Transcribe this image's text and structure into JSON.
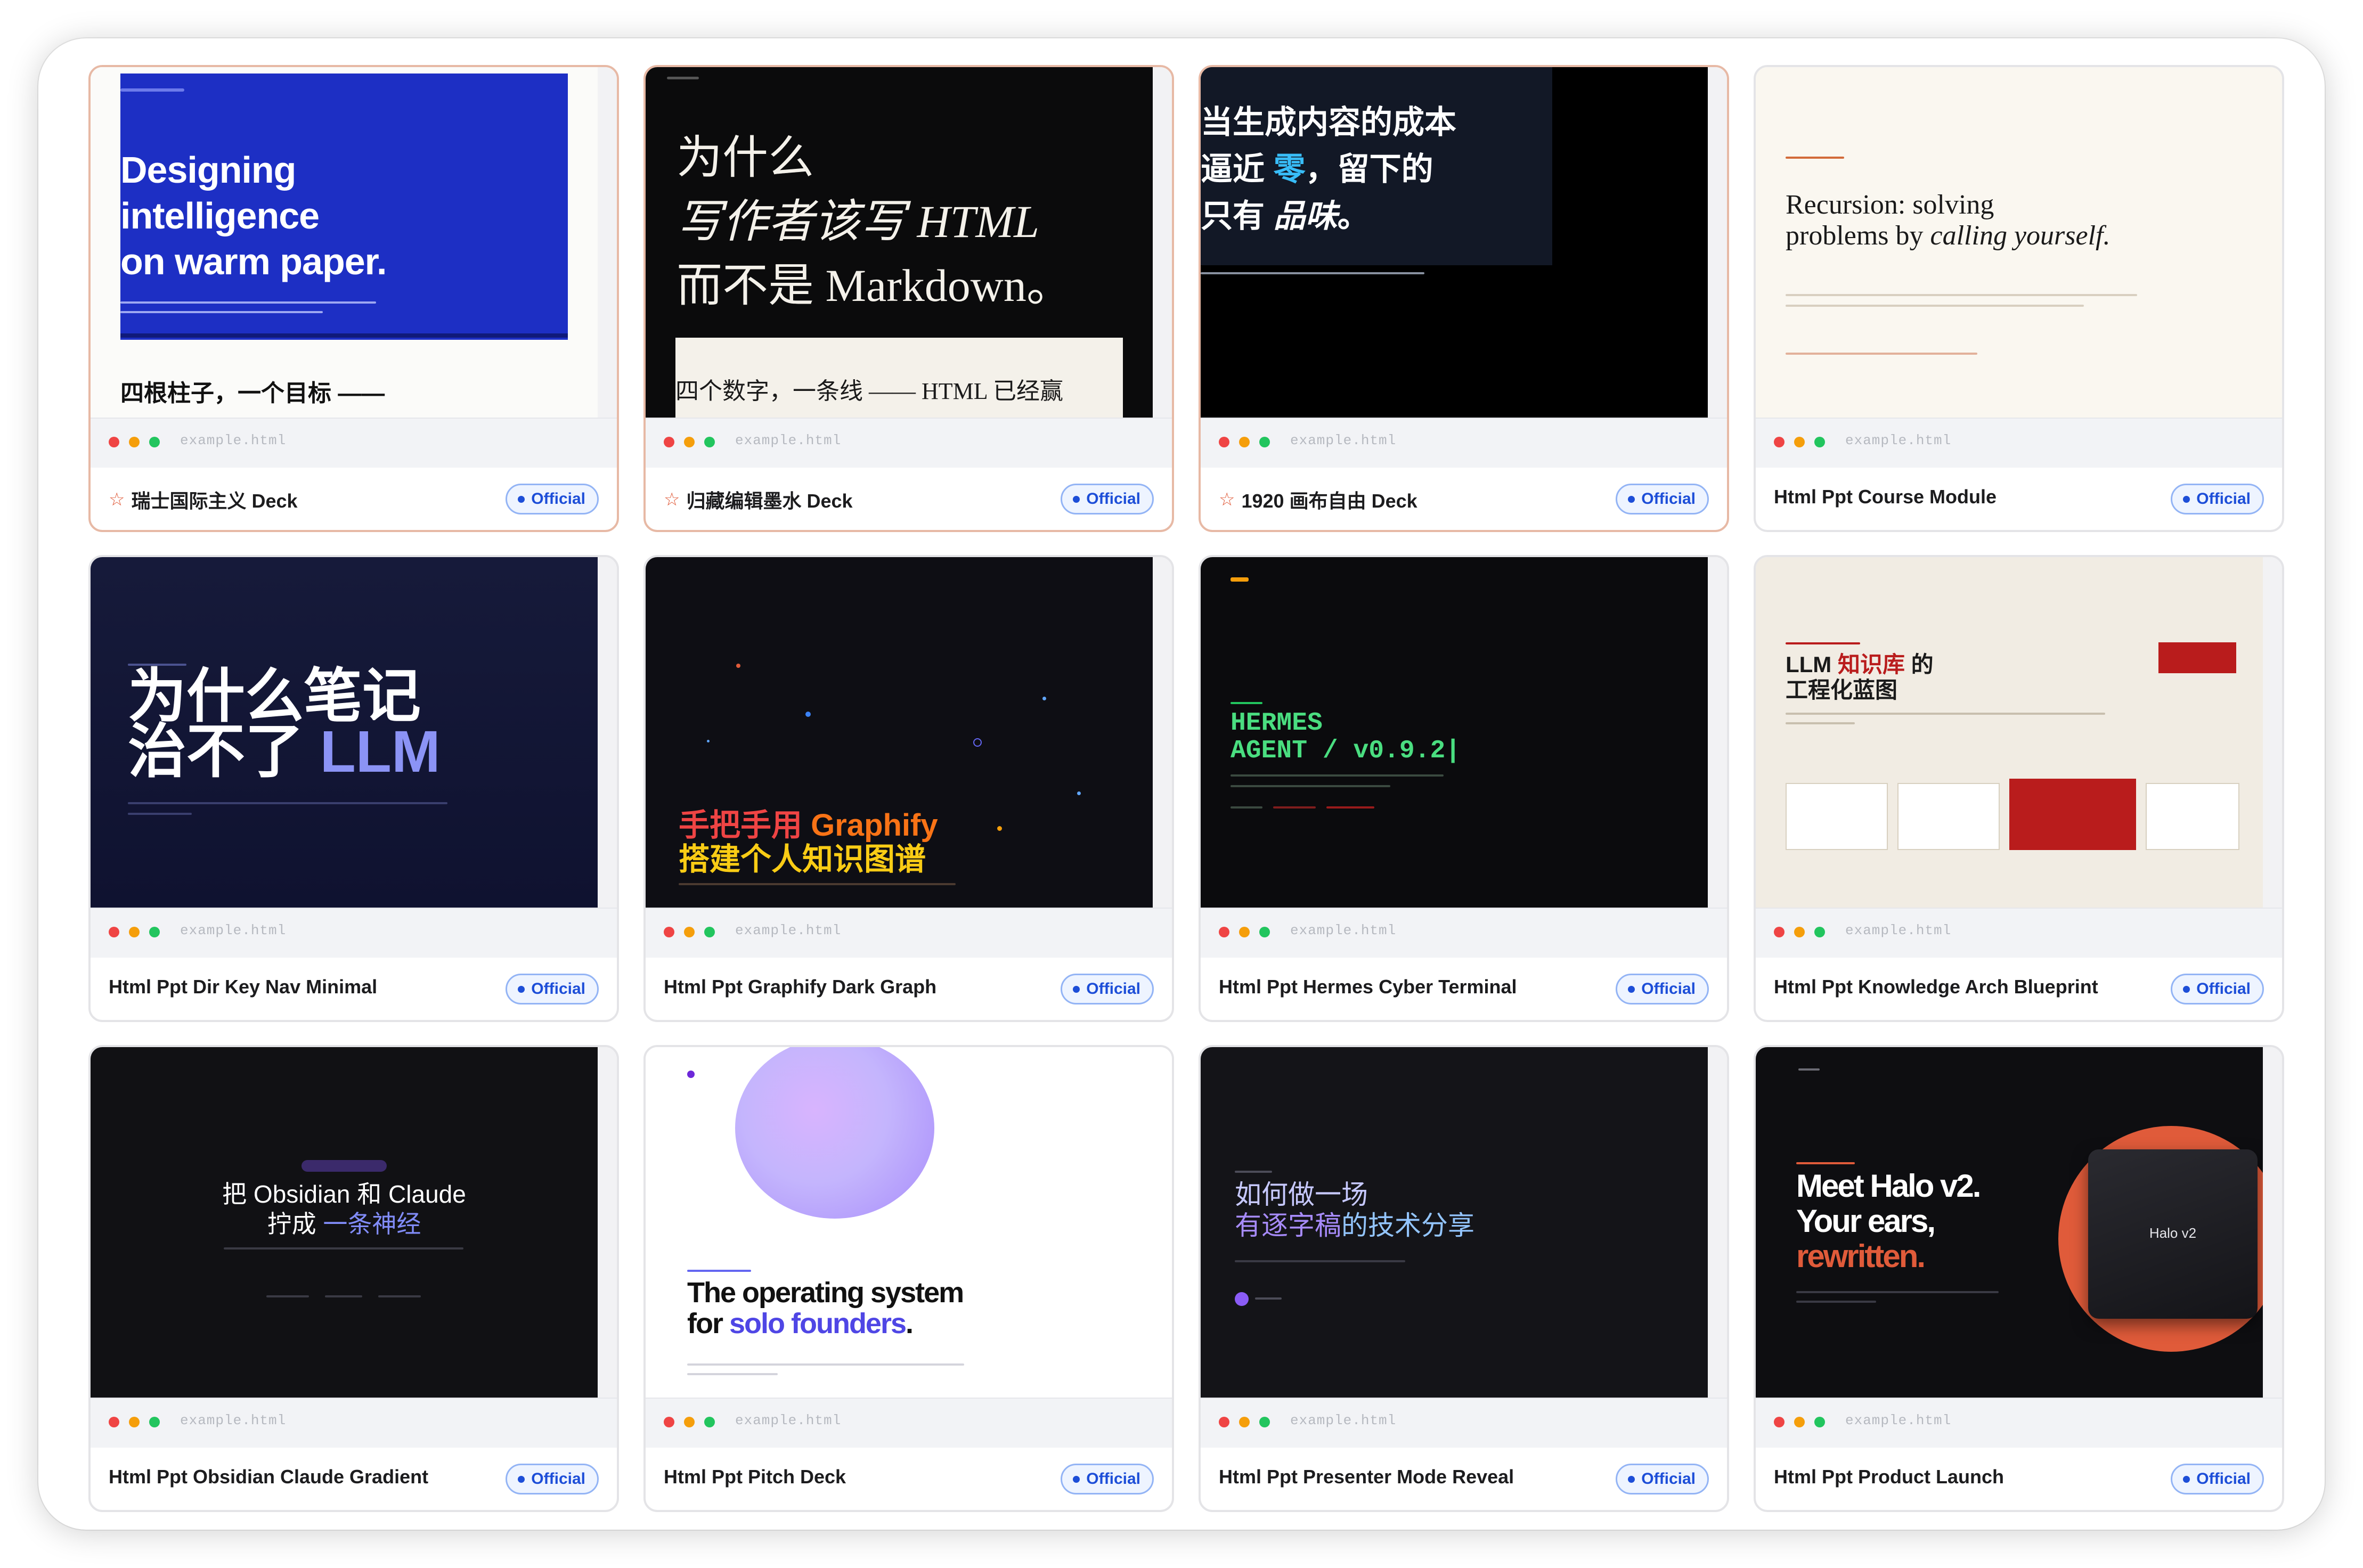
{
  "common": {
    "file_name": "example.html",
    "badge_label": "Official"
  },
  "cards": [
    {
      "title": "瑞士国际主义 Deck",
      "featured": true,
      "slide": {
        "heading_lines": [
          "Designing",
          "intelligence",
          "on warm paper."
        ],
        "sub_text": "四根柱子，一个目标 ——"
      }
    },
    {
      "title": "归藏编辑墨水 Deck",
      "featured": true,
      "slide": {
        "heading_lines": [
          "为什么",
          "写作者该写 HTML",
          "而不是 Markdown。"
        ],
        "sub_text": "四个数字，一条线 —— HTML 已经赢"
      }
    },
    {
      "title": "1920 画布自由 Deck",
      "featured": true,
      "slide": {
        "heading_line1": "当生成内容的成本",
        "heading_line2a": "逼近 ",
        "heading_line2b": "零",
        "heading_line2c": "，留下的",
        "heading_line3a": "只有 ",
        "heading_line3b": "品味",
        "heading_line3c": "。"
      }
    },
    {
      "title": "Html Ppt Course Module",
      "featured": false,
      "slide": {
        "heading_line1": "Recursion: solving",
        "heading_line2a": "problems by ",
        "heading_line2b": "calling yourself."
      }
    },
    {
      "title": "Html Ppt Dir Key Nav Minimal",
      "featured": false,
      "slide": {
        "heading_line1": "为什么笔记",
        "heading_line2a": "治不了 ",
        "heading_line2b": "LLM"
      }
    },
    {
      "title": "Html Ppt Graphify Dark Graph",
      "featured": false,
      "slide": {
        "heading_line1a": "手把手用 ",
        "heading_line1b": "Graphify",
        "heading_line2": "搭建个人知识图谱"
      }
    },
    {
      "title": "Html Ppt Hermes Cyber Terminal",
      "featured": false,
      "slide": {
        "heading_line1": "HERMES",
        "heading_line2": "AGENT / v0.9.2|"
      }
    },
    {
      "title": "Html Ppt Knowledge Arch Blueprint",
      "featured": false,
      "slide": {
        "heading_line1a": "LLM ",
        "heading_line1b": "知识库",
        "heading_line1c": " 的",
        "heading_line2": "工程化蓝图"
      }
    },
    {
      "title": "Html Ppt Obsidian Claude Gradient",
      "featured": false,
      "slide": {
        "heading_line1": "把 Obsidian 和 Claude",
        "heading_line2a": "拧成 ",
        "heading_line2b": "一条神经"
      }
    },
    {
      "title": "Html Ppt Pitch Deck",
      "featured": false,
      "slide": {
        "heading_line1": "The operating system",
        "heading_line2a": "for ",
        "heading_line2b": "solo founders",
        "heading_line2c": "."
      }
    },
    {
      "title": "Html Ppt Presenter Mode Reveal",
      "featured": false,
      "slide": {
        "heading_line1": "如何做一场",
        "heading_line2a": "有逐字稿",
        "heading_line2b": "的技术分享"
      }
    },
    {
      "title": "Html Ppt Product Launch",
      "featured": false,
      "slide": {
        "heading_line1": "Meet Halo v2.",
        "heading_line2": "Your ears,",
        "heading_line3": "rewritten.",
        "device_label": "Halo v2"
      }
    }
  ],
  "colors": {
    "accent_blue": "#1d4ed8",
    "badge_bg": "#eef4ff",
    "featured_border": "#e7b9a5",
    "star": "#e05b3a"
  },
  "icons": {
    "featured": "star-outline-icon",
    "window_controls": [
      "red-dot",
      "yellow-dot",
      "green-dot"
    ]
  }
}
